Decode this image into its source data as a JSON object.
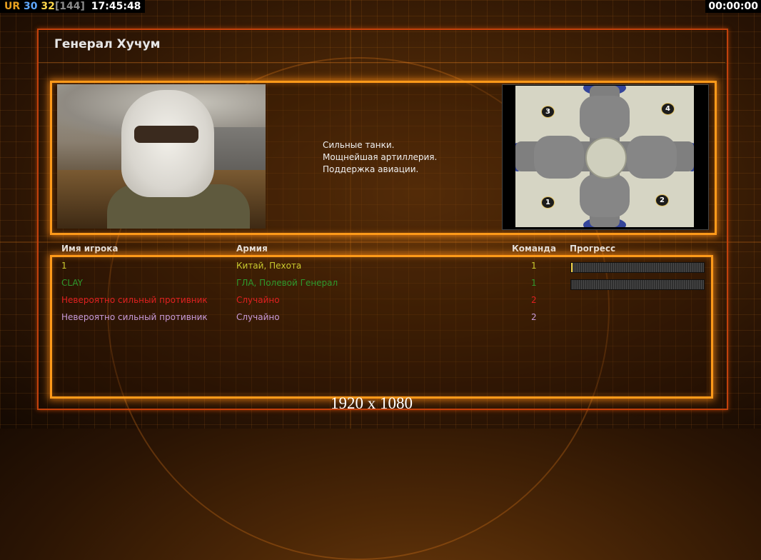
{
  "hud": {
    "ur": "UR",
    "n1": "30",
    "n2": "32",
    "n3": "[144]",
    "clock": "17:45:48",
    "timer": "00:00:00"
  },
  "general_name": "Генерал Хучум",
  "description": [
    "Сильные танки.",
    "Мощнейшая артиллерия.",
    "Поддержка авиации."
  ],
  "map": {
    "spawns": [
      "1",
      "2",
      "3",
      "4"
    ]
  },
  "columns": {
    "player": "Имя игрока",
    "army": "Армия",
    "team": "Команда",
    "progress": "Прогресс"
  },
  "players": [
    {
      "name": "1",
      "army": "Китай, Пехота",
      "team": "1",
      "color": "#c9c92e",
      "progress": 0.01,
      "has_bar": true
    },
    {
      "name": "CLAY",
      "army": "ГЛА, Полевой Генерал",
      "team": "1",
      "color": "#2e9a2e",
      "progress": 0.0,
      "has_bar": true
    },
    {
      "name": "Невероятно сильный противник",
      "army": "Случайно",
      "team": "2",
      "color": "#e02020",
      "has_bar": false
    },
    {
      "name": "Невероятно сильный противник",
      "army": "Случайно",
      "team": "2",
      "color": "#c89ad8",
      "has_bar": false
    }
  ],
  "resolution_label": "1920 x 1080"
}
